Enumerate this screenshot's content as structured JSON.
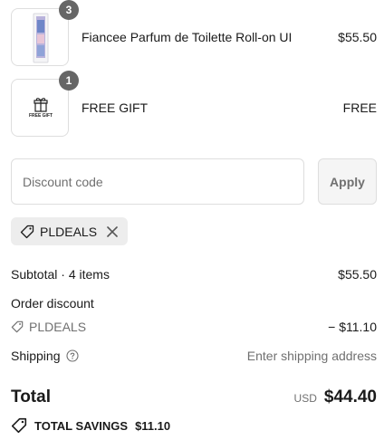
{
  "line_items": [
    {
      "name": "Fiancee Parfum de Toilette Roll-on UI",
      "price": "$55.50",
      "quantity": "3"
    },
    {
      "name": "FREE GIFT",
      "price": "FREE",
      "quantity": "1",
      "thumb_text": "FREE GIFT"
    }
  ],
  "discount": {
    "placeholder": "Discount code",
    "apply_label": "Apply",
    "applied_code": "PLDEALS"
  },
  "summary": {
    "subtotal_label": "Subtotal · 4 items",
    "subtotal_value": "$55.50",
    "order_discount_label": "Order discount",
    "discount_code": "PLDEALS",
    "discount_value": "− $11.10",
    "shipping_label": "Shipping",
    "shipping_value": "Enter shipping address",
    "total_label": "Total",
    "currency": "USD",
    "total_value": "$44.40",
    "savings_label": "TOTAL SAVINGS",
    "savings_value": "$11.10"
  }
}
